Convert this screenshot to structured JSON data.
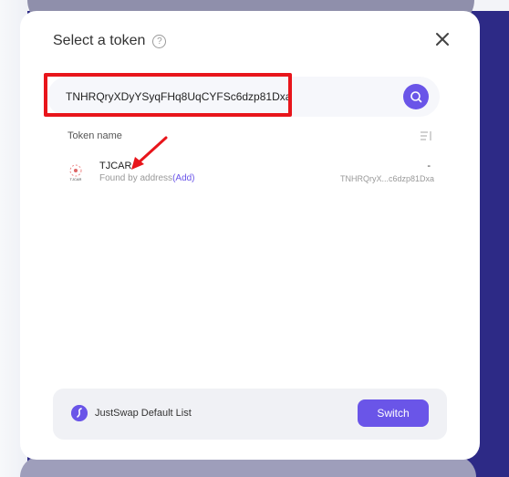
{
  "modal": {
    "title": "Select a token",
    "help_icon": "help-circle-icon",
    "close_icon": "close-icon"
  },
  "search": {
    "value": "TNHRQryXDyYSyqFHq8UqCYFSc6dzp81Dxa",
    "search_icon": "search-icon"
  },
  "list_header": {
    "column_label": "Token name",
    "sort_icon": "sort-icon"
  },
  "tokens": [
    {
      "symbol": "TJCAR",
      "found_by": "Found by address",
      "add_label": "(Add)",
      "balance": "-",
      "address_short": "TNHRQryX...c6dzp81Dxa",
      "logo_icon": "tjcar-logo-icon",
      "logo_text": "TJCAR"
    }
  ],
  "token_list": {
    "name": "JustSwap Default List",
    "logo_icon": "justswap-logo-icon",
    "switch_label": "Switch"
  },
  "colors": {
    "accent": "#6a55e8",
    "highlight": "#e8151b",
    "background": "#2d2a86"
  }
}
